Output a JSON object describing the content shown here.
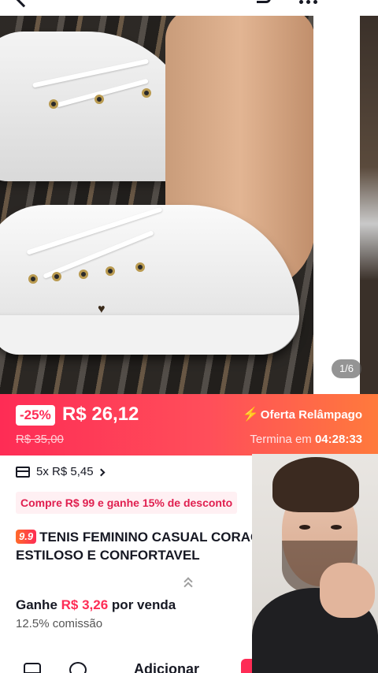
{
  "gallery": {
    "pager": "1/6"
  },
  "flash_sale": {
    "discount": "-25%",
    "price": "R$ 26,12",
    "old_price": "R$ 35,00",
    "label": "Oferta Relâmpago",
    "ends_prefix": "Termina em",
    "countdown": "04:28:33"
  },
  "installments": {
    "text": "5x R$ 5,45"
  },
  "promo": {
    "text": "Compre R$ 99 e ganhe 15% de desconto"
  },
  "product": {
    "badge": "9.9",
    "title": "TENIS FEMININO CASUAL CORAÇ ADULTO ESTILOSO E CONFORTAVEL"
  },
  "earnings": {
    "prefix": "Ganhe",
    "amount": "R$ 3,26",
    "suffix": "por venda",
    "commission": "12.5% comissão"
  },
  "bottom_bar": {
    "add_label": "Adicionar"
  },
  "colors": {
    "accent": "#fe2c55",
    "flash_gradient_end": "#ff7a3c"
  }
}
